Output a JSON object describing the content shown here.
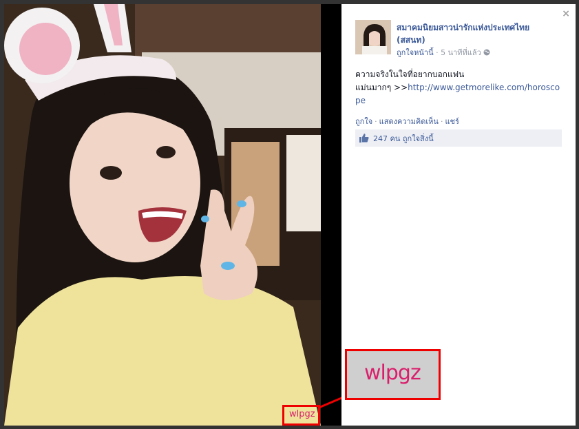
{
  "close": {
    "label": "×"
  },
  "post": {
    "page_name": "สมาคมนิยมสาวน่ารักแห่งประเทศไทย (สสนท)",
    "like_page": "ถูกใจหน้านี้",
    "separator": "·",
    "time": "5 นาทีที่แล้ว",
    "text_line1": "ความจริงในใจที่อยากบอกแฟน",
    "text_line2": "แม่นมากๆ >>",
    "link": "http://www.getmorelike.com/horoscope",
    "actions": {
      "like": "ถูกใจ",
      "comment": "แสดงความคิดเห็น",
      "share": "แชร์"
    },
    "likes_count": "247 คน",
    "likes_text": "ถูกใจสิ่งนี้"
  },
  "watermark": {
    "text": "wlpgz"
  },
  "colors": {
    "brand": "#3b5998",
    "highlight": "#ee0000",
    "watermark": "#d91f6c"
  },
  "icons": {
    "globe": "globe-icon",
    "thumbs_up": "thumbs-up-icon",
    "close": "close-icon"
  }
}
